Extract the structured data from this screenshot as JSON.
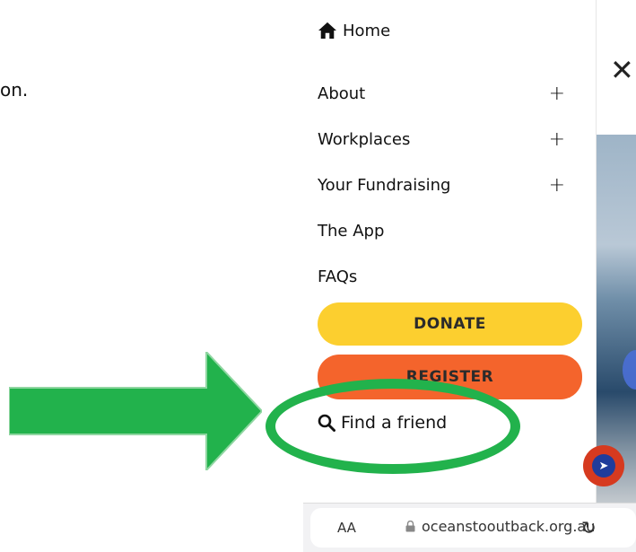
{
  "background_text": "on.",
  "menu": {
    "home_label": "Home",
    "items": [
      {
        "label": "About",
        "expander": "+"
      },
      {
        "label": "Workplaces",
        "expander": "+"
      },
      {
        "label": "Your Fundraising",
        "expander": "+"
      },
      {
        "label": "The App",
        "expander": ""
      },
      {
        "label": "FAQs",
        "expander": ""
      }
    ],
    "donate_label": "DONATE",
    "register_label": "REGISTER",
    "find_friend_label": "Find a friend"
  },
  "page": {
    "close_glyph": "✕"
  },
  "browser": {
    "text_size_label": "AA",
    "url": "oceanstooutback.org.au",
    "reload_glyph": "↻"
  },
  "colors": {
    "donate": "#fccf2f",
    "register": "#f4642c",
    "annotation_green": "#22b24c"
  },
  "icons": [
    "home-icon",
    "search-icon",
    "close-icon",
    "lock-icon",
    "reload-icon",
    "app-fab-icon"
  ]
}
